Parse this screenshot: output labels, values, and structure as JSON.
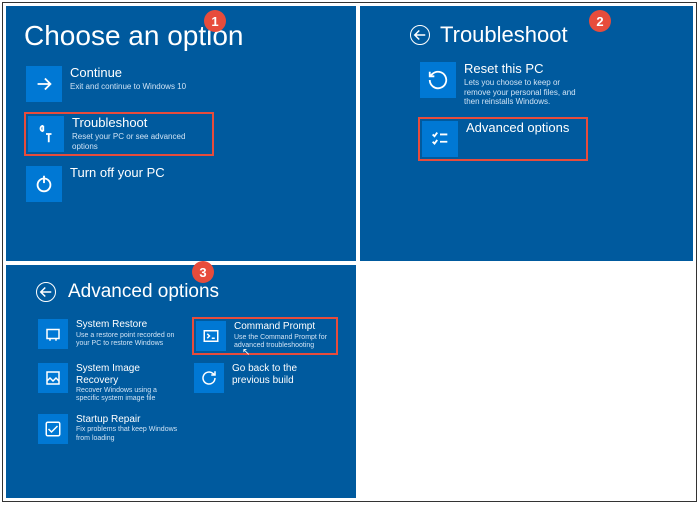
{
  "panels": {
    "choose": {
      "badge": "1",
      "title": "Choose an option",
      "tiles": [
        {
          "label": "Continue",
          "sub": "Exit and continue to Windows 10"
        },
        {
          "label": "Troubleshoot",
          "sub": "Reset your PC or see advanced options"
        },
        {
          "label": "Turn off your PC",
          "sub": ""
        }
      ]
    },
    "troubleshoot": {
      "badge": "2",
      "title": "Troubleshoot",
      "tiles": [
        {
          "label": "Reset this PC",
          "sub": "Lets you choose to keep or remove your personal files, and then reinstalls Windows."
        },
        {
          "label": "Advanced options",
          "sub": ""
        }
      ]
    },
    "advanced": {
      "badge": "3",
      "title": "Advanced options",
      "tiles": [
        {
          "label": "System Restore",
          "sub": "Use a restore point recorded on your PC to restore Windows"
        },
        {
          "label": "Command Prompt",
          "sub": "Use the Command Prompt for advanced troubleshooting"
        },
        {
          "label": "System Image Recovery",
          "sub": "Recover Windows using a specific system image file"
        },
        {
          "label": "Go back to the previous build",
          "sub": ""
        },
        {
          "label": "Startup Repair",
          "sub": "Fix problems that keep Windows from loading"
        }
      ]
    }
  }
}
